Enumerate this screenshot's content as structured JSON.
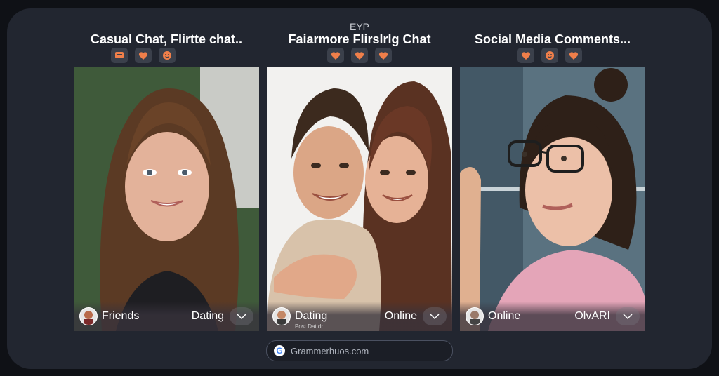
{
  "header": {
    "label": "EYP"
  },
  "columns": [
    {
      "title": "Casual Chat, Flirtte chat..",
      "reactions": [
        "chat-icon",
        "heart-icon",
        "smiley-icon"
      ],
      "left_label": "Friends",
      "right_label": "Dating"
    },
    {
      "title": "Faiarmore Flirslrlg Chat",
      "reactions": [
        "heart-icon",
        "heart-icon",
        "heart-icon"
      ],
      "left_label": "Dating",
      "right_label": "Online",
      "sub_caption": "Post Dat dr"
    },
    {
      "title": "Social Media Comments...",
      "reactions": [
        "heart-icon",
        "smiley-icon",
        "heart-icon"
      ],
      "left_label": "Online",
      "right_label": "OlvARI"
    }
  ],
  "search": {
    "text": "Grammerhuos.com",
    "icon": "google-icon"
  },
  "colors": {
    "accent": "#f07f4a",
    "background": "#222630"
  }
}
